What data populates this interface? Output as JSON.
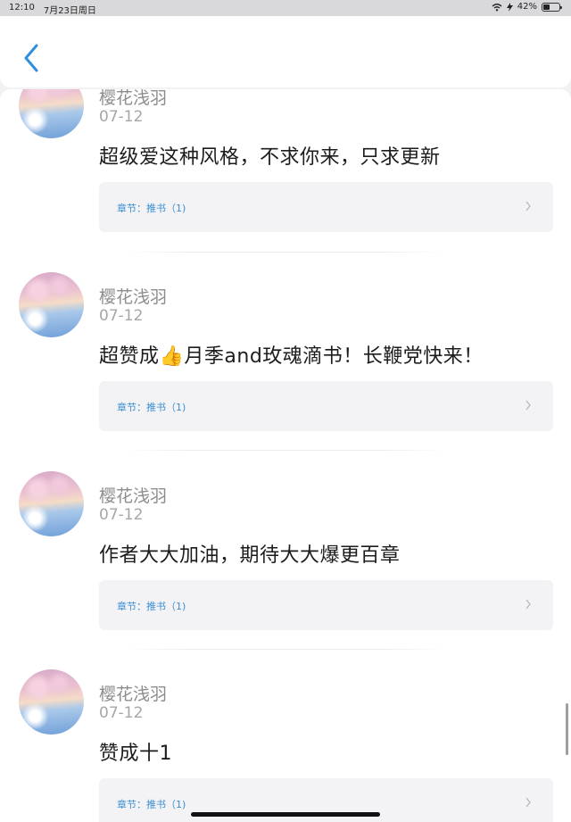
{
  "status_bar": {
    "time": "12:10",
    "date": "7月23日周日",
    "battery_percent": "42%",
    "battery_level": 0.42,
    "icons": [
      "wifi-icon",
      "charging-icon",
      "battery-icon"
    ]
  },
  "nav": {
    "back_icon": "chevron-left-icon",
    "accent_color": "#2f8fde"
  },
  "comments": [
    {
      "username": "樱花浅羽",
      "date": "07-12",
      "text": "超级爱这种风格，不求你来，只求更新",
      "chapter": "章节：推书（1)"
    },
    {
      "username": "樱花浅羽",
      "date": "07-12",
      "text": "超赞成👍月季and玫魂滴书！长鞭党快来！",
      "chapter": "章节：推书（1)"
    },
    {
      "username": "樱花浅羽",
      "date": "07-12",
      "text": "作者大大加油，期待大大爆更百章",
      "chapter": "章节：推书（1)"
    },
    {
      "username": "樱花浅羽",
      "date": "07-12",
      "text": "赞成十1",
      "chapter": "章节：推书（1)"
    }
  ]
}
